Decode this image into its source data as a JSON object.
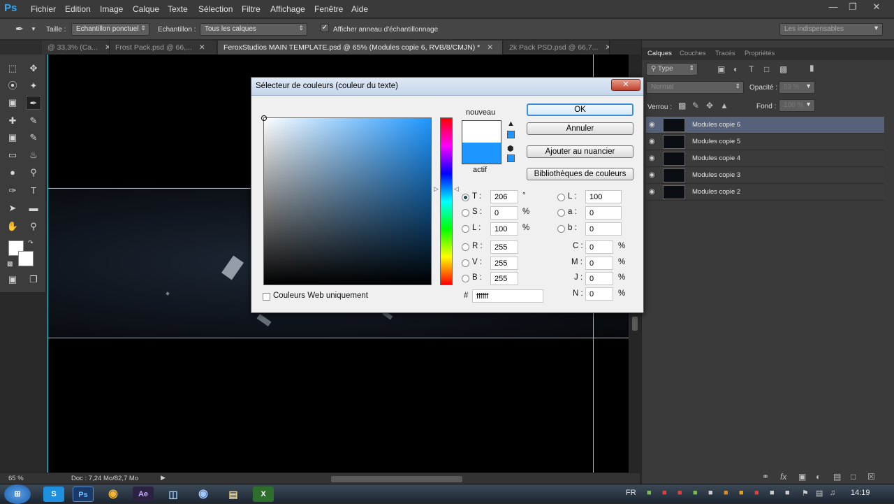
{
  "app": {
    "logo": "Ps"
  },
  "menu": [
    "Fichier",
    "Edition",
    "Image",
    "Calque",
    "Texte",
    "Sélection",
    "Filtre",
    "Affichage",
    "Fenêtre",
    "Aide"
  ],
  "options_bar": {
    "taille_label": "Taille :",
    "taille_value": "Echantillon ponctuel",
    "echantillon_label": "Echantillon :",
    "echantillon_value": "Tous les calques",
    "ring_label": "Afficher anneau d'échantillonnage",
    "workspace": "Les indispensables"
  },
  "doc_tabs": [
    {
      "label": "@ 33,3% (Ca...",
      "active": false
    },
    {
      "label": "Frost Pack.psd @ 66,...",
      "active": false
    },
    {
      "label": "FeroxStudios MAIN TEMPLATE.psd @ 65% (Modules copie 6, RVB/8/CMJN) *",
      "active": true
    },
    {
      "label": "2k Pack PSD.psd @ 66,7...",
      "active": false
    }
  ],
  "status": {
    "zoom": "65 %",
    "doc": "Doc : 7,24 Mo/82,7 Mo"
  },
  "panel": {
    "tabs": [
      "Calques",
      "Couches",
      "Tracés",
      "Propriétés"
    ],
    "filter_label": "Type",
    "blend_mode": "Normal",
    "opacity_label": "Opacité :",
    "opacity_value": "53 %",
    "lock_label": "Verrou :",
    "fill_label": "Fond :",
    "fill_value": "100 %",
    "layers": [
      {
        "name": "Modules copie 6",
        "selected": true
      },
      {
        "name": "Modules copie 5",
        "selected": false
      },
      {
        "name": "Modules copie 4",
        "selected": false
      },
      {
        "name": "Modules copie 3",
        "selected": false
      },
      {
        "name": "Modules copie 2",
        "selected": false
      }
    ]
  },
  "dialog": {
    "title": "Sélecteur de couleurs (couleur du texte)",
    "nouveau": "nouveau",
    "actif": "actif",
    "new_color": "#ffffff",
    "current_color": "#1e96ff",
    "buttons": {
      "ok": "OK",
      "cancel": "Annuler",
      "add_swatch": "Ajouter au nuancier",
      "libraries": "Bibliothèques de couleurs"
    },
    "fields": {
      "T": "206",
      "S": "0",
      "L": "100",
      "R": "255",
      "V": "255",
      "B": "255",
      "Lab_L": "100",
      "a": "0",
      "b": "0",
      "C": "0",
      "M": "0",
      "J": "0",
      "N": "0",
      "hex": "ffffff"
    },
    "labels": {
      "T": "T :",
      "S": "S :",
      "L": "L :",
      "R": "R :",
      "V": "V :",
      "B": "B :",
      "Lab_L": "L :",
      "a": "a :",
      "b": "b :",
      "C": "C :",
      "M": "M :",
      "J": "J :",
      "N": "N :",
      "hash": "#",
      "deg": "°",
      "pct": "%"
    },
    "web_only": "Couleurs Web uniquement"
  },
  "taskbar": {
    "lang": "FR",
    "time": "14:19"
  }
}
